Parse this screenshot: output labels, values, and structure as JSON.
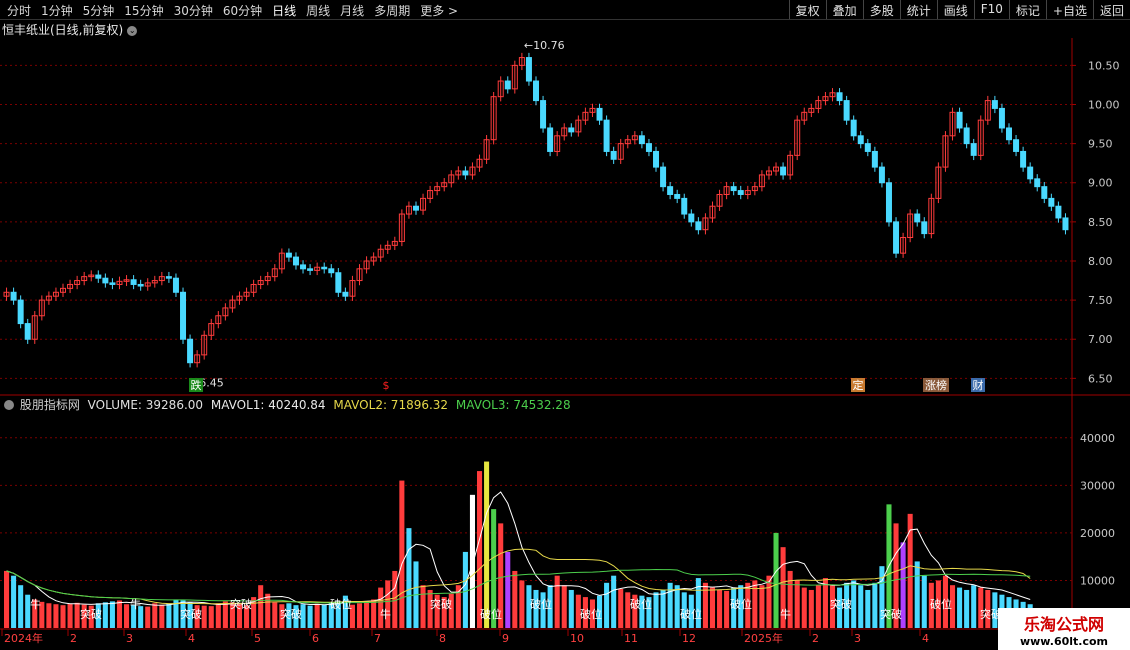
{
  "toolbar": {
    "periods": [
      "分时",
      "1分钟",
      "5分钟",
      "15分钟",
      "30分钟",
      "60分钟",
      "日线",
      "周线",
      "月线",
      "多周期",
      "更多 >"
    ],
    "active_period": "日线",
    "right_buttons": [
      "复权",
      "叠加",
      "多股",
      "统计",
      "画线",
      "F10",
      "标记",
      "+自选",
      "返回"
    ]
  },
  "stock_title": "恒丰纸业(日线,前复权)",
  "price_axis": [
    "10.50",
    "10.00",
    "9.50",
    "9.00",
    "8.50",
    "8.00",
    "7.50",
    "7.00",
    "6.50"
  ],
  "annotations": {
    "high": "10.76",
    "low": "6.45"
  },
  "event_markers": [
    {
      "text": "跌",
      "color": "#1a8a1a"
    },
    {
      "text": "$",
      "color": "#ff2020"
    },
    {
      "text": "定",
      "color": "#c87a30"
    },
    {
      "text": "涨榜",
      "color": "#8a5a3a"
    },
    {
      "text": "财",
      "color": "#3a6aaa"
    }
  ],
  "indicator": {
    "name": "股朋指标网",
    "volume_label": "VOLUME: 39286.00",
    "mavol1_label": "MAVOL1: 40240.84",
    "mavol2_label": "MAVOL2: 71896.32",
    "mavol3_label": "MAVOL3: 74532.28"
  },
  "volume_axis": [
    "40000",
    "30000",
    "20000",
    "10000"
  ],
  "volume_signals": [
    "牛",
    "突破",
    "牛",
    "突破",
    "突破",
    "突破",
    "破位",
    "牛",
    "突破",
    "破位",
    "破位",
    "破位",
    "破位",
    "破位",
    "破位",
    "牛",
    "突破",
    "突破",
    "破位",
    "突破"
  ],
  "time_axis": [
    "2024年",
    "2",
    "3",
    "4",
    "5",
    "6",
    "7",
    "8",
    "9",
    "10",
    "11",
    "12",
    "2025年",
    "2",
    "3",
    "4"
  ],
  "watermark": {
    "title": "乐淘公式网",
    "url": "www.60lt.com"
  },
  "chart_data": {
    "type": "candlestick",
    "price_range": [
      6.3,
      10.85
    ],
    "high": 10.76,
    "low": 6.45,
    "closes": [
      7.6,
      7.5,
      7.2,
      7.0,
      7.3,
      7.5,
      7.55,
      7.6,
      7.65,
      7.7,
      7.75,
      7.8,
      7.82,
      7.78,
      7.72,
      7.7,
      7.74,
      7.76,
      7.7,
      7.68,
      7.72,
      7.75,
      7.8,
      7.78,
      7.6,
      7.0,
      6.7,
      6.8,
      7.05,
      7.2,
      7.3,
      7.4,
      7.5,
      7.55,
      7.6,
      7.7,
      7.75,
      7.8,
      7.9,
      8.1,
      8.05,
      7.95,
      7.9,
      7.88,
      7.92,
      7.9,
      7.85,
      7.6,
      7.55,
      7.75,
      7.9,
      8.0,
      8.05,
      8.15,
      8.2,
      8.25,
      8.6,
      8.7,
      8.65,
      8.8,
      8.9,
      8.95,
      9.0,
      9.1,
      9.15,
      9.1,
      9.2,
      9.3,
      9.55,
      10.1,
      10.3,
      10.2,
      10.5,
      10.6,
      10.3,
      10.05,
      9.7,
      9.4,
      9.6,
      9.7,
      9.65,
      9.8,
      9.9,
      9.95,
      9.8,
      9.4,
      9.3,
      9.5,
      9.55,
      9.6,
      9.5,
      9.4,
      9.2,
      8.95,
      8.85,
      8.8,
      8.6,
      8.5,
      8.4,
      8.55,
      8.7,
      8.85,
      8.95,
      8.9,
      8.85,
      8.9,
      8.95,
      9.1,
      9.15,
      9.2,
      9.1,
      9.35,
      9.8,
      9.9,
      9.95,
      10.05,
      10.1,
      10.15,
      10.05,
      9.8,
      9.6,
      9.5,
      9.4,
      9.2,
      9.0,
      8.5,
      8.1,
      8.3,
      8.6,
      8.5,
      8.35,
      8.8,
      9.2,
      9.6,
      9.9,
      9.7,
      9.5,
      9.35,
      9.8,
      10.05,
      9.95,
      9.7,
      9.55,
      9.4,
      9.2,
      9.05,
      8.95,
      8.8,
      8.7,
      8.55,
      8.4
    ],
    "volume_range": [
      0,
      45000
    ],
    "volume_ticks": [
      10000,
      20000,
      30000,
      40000
    ],
    "volumes": [
      12000,
      11000,
      9000,
      7000,
      6000,
      5500,
      5200,
      5000,
      4800,
      5100,
      5300,
      4900,
      4700,
      5200,
      5400,
      5600,
      5800,
      5000,
      4800,
      4600,
      4500,
      5200,
      4900,
      5100,
      6000,
      5800,
      5400,
      4800,
      4700,
      4600,
      5200,
      5600,
      5400,
      5100,
      4800,
      6500,
      9000,
      7200,
      5400,
      5000,
      5200,
      4800,
      5000,
      4700,
      5100,
      4900,
      5300,
      5600,
      6800,
      4900,
      5200,
      5600,
      6000,
      8500,
      10000,
      12000,
      31000,
      21000,
      14000,
      9000,
      8000,
      7000,
      6500,
      7200,
      9000,
      16000,
      28000,
      33000,
      35000,
      25000,
      22000,
      16000,
      12000,
      10000,
      9000,
      8000,
      7500,
      9000,
      11000,
      9000,
      8000,
      7000,
      6500,
      6000,
      6800,
      9500,
      11000,
      8200,
      7500,
      7000,
      6800,
      6500,
      7500,
      8000,
      9500,
      9000,
      7500,
      7000,
      10500,
      9500,
      8500,
      8000,
      7800,
      8500,
      9000,
      9500,
      10000,
      9000,
      11000,
      20000,
      17000,
      12000,
      10000,
      8500,
      8000,
      9000,
      10500,
      9000,
      8500,
      9500,
      10000,
      9000,
      8000,
      9500,
      13000,
      26000,
      22000,
      18000,
      24000,
      14000,
      11000,
      9500,
      10000,
      11000,
      9000,
      8500,
      8000,
      9000,
      8500,
      8000,
      7500,
      7000,
      6500,
      6000,
      5500,
      5000
    ]
  }
}
